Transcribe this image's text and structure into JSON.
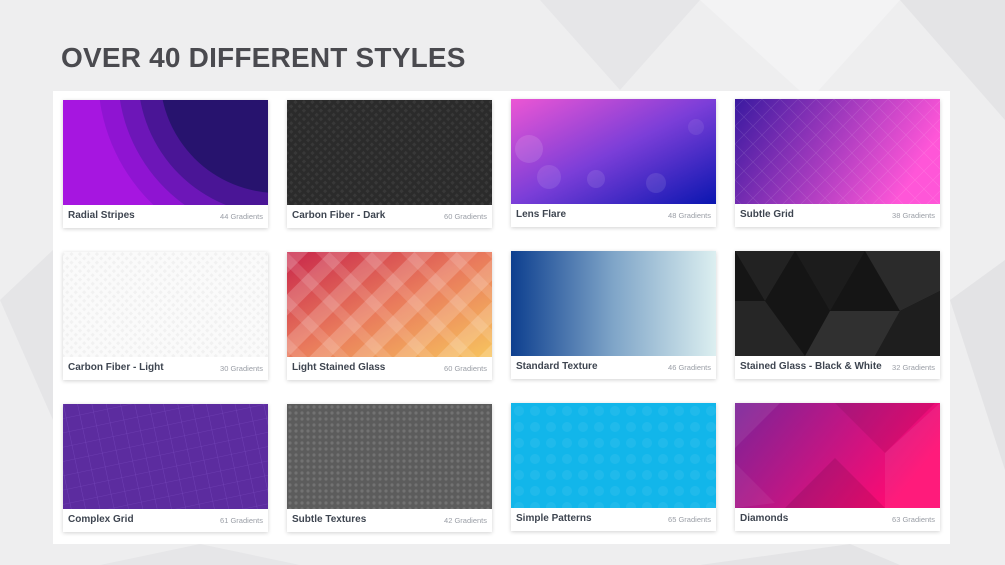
{
  "page": {
    "title": "OVER 40 DIFFERENT STYLES"
  },
  "styles": [
    {
      "name": "Radial Stripes",
      "count": "44 Gradients",
      "icon": "radial-stripes-swatch",
      "colors": [
        "#b01de8",
        "#27136e"
      ]
    },
    {
      "name": "Carbon Fiber - Dark",
      "count": "60 Gradients",
      "icon": "carbon-fiber-dark-swatch",
      "colors": [
        "#2a2a2a",
        "#3a3a3a"
      ]
    },
    {
      "name": "Lens Flare",
      "count": "48 Gradients",
      "icon": "lens-flare-swatch",
      "colors": [
        "#e84fd6",
        "#0a16b0"
      ]
    },
    {
      "name": "Subtle Grid",
      "count": "38 Gradients",
      "icon": "subtle-grid-swatch",
      "colors": [
        "#3a1aa0",
        "#ff56d8"
      ]
    },
    {
      "name": "Carbon Fiber - Light",
      "count": "30 Gradients",
      "icon": "carbon-fiber-light-swatch",
      "colors": [
        "#fafafa",
        "#f0f0f0"
      ]
    },
    {
      "name": "Light Stained Glass",
      "count": "60 Gradients",
      "icon": "light-stained-glass-swatch",
      "colors": [
        "#c8264a",
        "#f7c45e"
      ]
    },
    {
      "name": "Standard Texture",
      "count": "46 Gradients",
      "icon": "standard-texture-swatch",
      "colors": [
        "#0d3f8f",
        "#dceff0"
      ]
    },
    {
      "name": "Stained Glass - Black & White",
      "count": "32 Gradients",
      "icon": "stained-glass-bw-swatch",
      "colors": [
        "#111111",
        "#2c2c2c"
      ]
    },
    {
      "name": "Complex Grid",
      "count": "61 Gradients",
      "icon": "complex-grid-swatch",
      "colors": [
        "#5b2a9e",
        "#6a34ae"
      ]
    },
    {
      "name": "Subtle Textures",
      "count": "42 Gradients",
      "icon": "subtle-textures-swatch",
      "colors": [
        "#5a5a5a",
        "#6e6e6e"
      ]
    },
    {
      "name": "Simple Patterns",
      "count": "65 Gradients",
      "icon": "simple-patterns-swatch",
      "colors": [
        "#14b8ea",
        "#0fb1e6"
      ]
    },
    {
      "name": "Diamonds",
      "count": "63 Gradients",
      "icon": "diamonds-swatch",
      "colors": [
        "#7a2398",
        "#ff0a72"
      ]
    }
  ]
}
